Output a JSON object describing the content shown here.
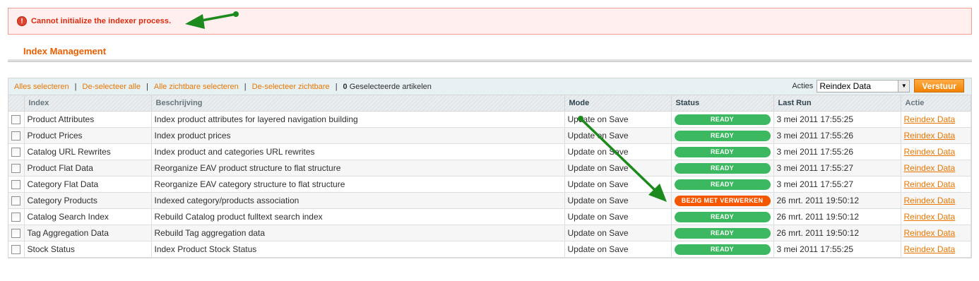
{
  "error": {
    "icon": "exclamation-icon",
    "message": "Cannot initialize the indexer process."
  },
  "page": {
    "title": "Index Management"
  },
  "massaction": {
    "select_all": "Alles selecteren",
    "unselect_all": "De-selecteer alle",
    "select_visible": "Alle zichtbare selecteren",
    "unselect_visible": "De-selecteer zichtbare",
    "selected_count": "0",
    "selected_label": "Geselecteerde artikelen",
    "actions_label": "Acties",
    "action_value": "Reindex Data",
    "submit_label": "Verstuur"
  },
  "columns": [
    "Index",
    "Beschrijving",
    "Mode",
    "Status",
    "Last Run",
    "Actie"
  ],
  "rows": [
    {
      "index": "Product Attributes",
      "description": "Index product attributes for layered navigation building",
      "mode": "Update on Save",
      "status": "READY",
      "last_run": "3 mei 2011 17:55:25",
      "action": "Reindex Data"
    },
    {
      "index": "Product Prices",
      "description": "Index product prices",
      "mode": "Update on Save",
      "status": "READY",
      "last_run": "3 mei 2011 17:55:26",
      "action": "Reindex Data"
    },
    {
      "index": "Catalog URL Rewrites",
      "description": "Index product and categories URL rewrites",
      "mode": "Update on Save",
      "status": "READY",
      "last_run": "3 mei 2011 17:55:26",
      "action": "Reindex Data"
    },
    {
      "index": "Product Flat Data",
      "description": "Reorganize EAV product structure to flat structure",
      "mode": "Update on Save",
      "status": "READY",
      "last_run": "3 mei 2011 17:55:27",
      "action": "Reindex Data"
    },
    {
      "index": "Category Flat Data",
      "description": "Reorganize EAV category structure to flat structure",
      "mode": "Update on Save",
      "status": "READY",
      "last_run": "3 mei 2011 17:55:27",
      "action": "Reindex Data"
    },
    {
      "index": "Category Products",
      "description": "Indexed category/products association",
      "mode": "Update on Save",
      "status": "BEZIG MET VERWERKEN",
      "last_run": "26 mrt. 2011 19:50:12",
      "action": "Reindex Data"
    },
    {
      "index": "Catalog Search Index",
      "description": "Rebuild Catalog product fulltext search index",
      "mode": "Update on Save",
      "status": "READY",
      "last_run": "26 mrt. 2011 19:50:12",
      "action": "Reindex Data"
    },
    {
      "index": "Tag Aggregation Data",
      "description": "Rebuild Tag aggregation data",
      "mode": "Update on Save",
      "status": "READY",
      "last_run": "26 mrt. 2011 19:50:12",
      "action": "Reindex Data"
    },
    {
      "index": "Stock Status",
      "description": "Index Product Stock Status",
      "mode": "Update on Save",
      "status": "READY",
      "last_run": "3 mei 2011 17:55:25",
      "action": "Reindex Data"
    }
  ],
  "colors": {
    "ready": "#3cb861",
    "busy": "#f55600",
    "accent": "#ea7601",
    "annotation_arrow": "#1c8a1c"
  }
}
